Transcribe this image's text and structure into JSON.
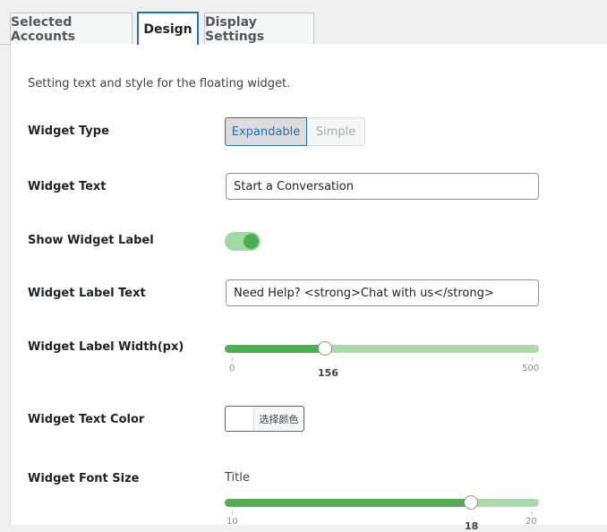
{
  "tabs": [
    {
      "label": "Selected Accounts",
      "active": false
    },
    {
      "label": "Design",
      "active": true
    },
    {
      "label": "Display Settings",
      "active": false
    }
  ],
  "description": "Setting text and style for the floating widget.",
  "widget_type": {
    "label": "Widget Type",
    "options": [
      "Expandable",
      "Simple"
    ],
    "selected": "Expandable"
  },
  "widget_text": {
    "label": "Widget Text",
    "value": "Start a Conversation"
  },
  "show_widget_label": {
    "label": "Show Widget Label",
    "enabled": true
  },
  "widget_label_text": {
    "label": "Widget Label Text",
    "value": "Need Help? <strong>Chat with us</strong>"
  },
  "widget_label_width": {
    "label": "Widget Label Width(px)",
    "min": "0",
    "max": "500",
    "value": "156"
  },
  "widget_text_color": {
    "label": "Widget Text Color",
    "button_label": "选择颜色",
    "swatch_color": "#ffffff"
  },
  "widget_font_size": {
    "label": "Widget Font Size",
    "sub_label": "Title",
    "min": "10",
    "max": "20",
    "value": "18"
  },
  "colors": {
    "accent": "#2271b1",
    "slider_fill": "#4caf50",
    "slider_track": "#a8dba8"
  }
}
